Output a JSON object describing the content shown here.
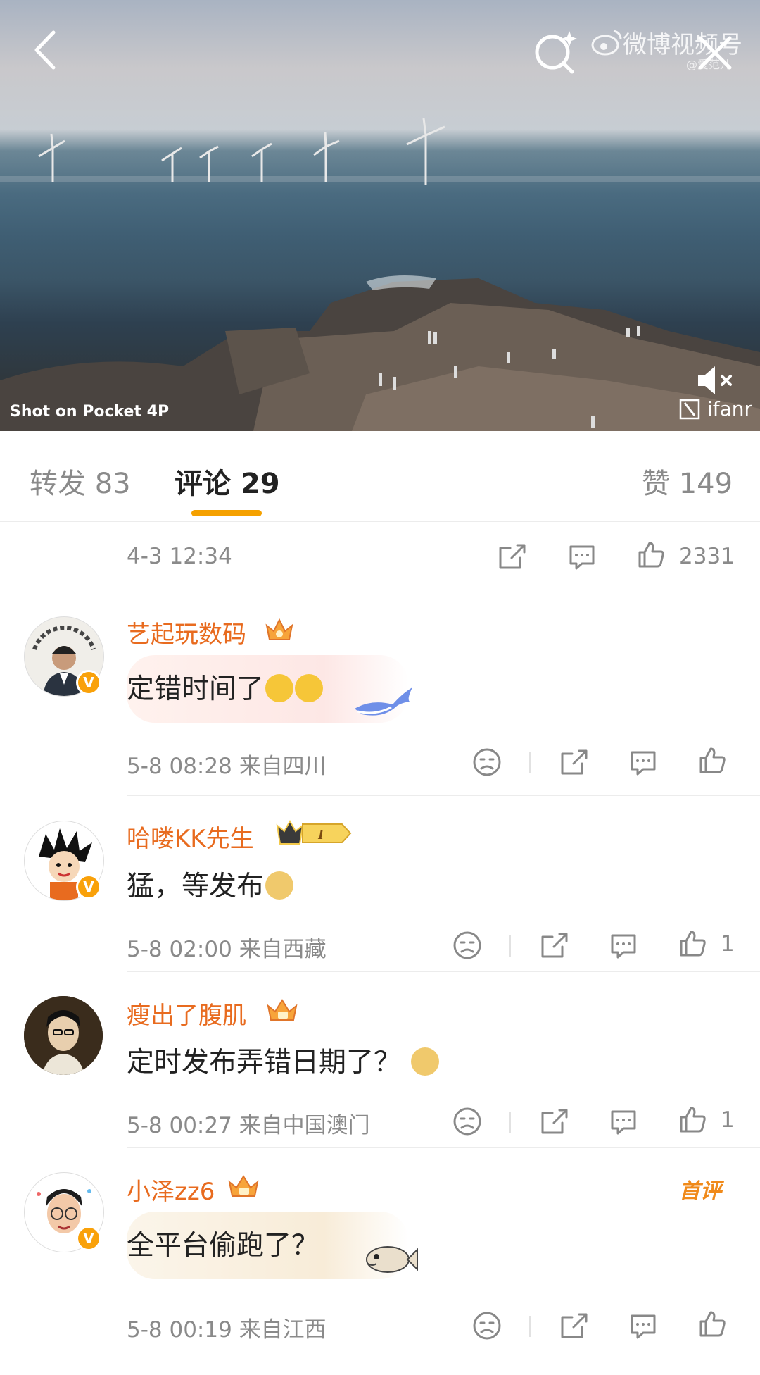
{
  "video": {
    "watermark_brand": "微博视频号",
    "watermark_user": "@爱范儿",
    "caption": "Shot on Pocket 4P",
    "brand": "ifanr"
  },
  "tabs": [
    {
      "label": "转发",
      "count": "83"
    },
    {
      "label": "评论",
      "count": "29"
    },
    {
      "label": "赞",
      "count": "149"
    }
  ],
  "post": {
    "time": "4-3 12:34",
    "likes": "2331"
  },
  "comments": [
    {
      "user": "艺起玩数码",
      "text": "定错时间了",
      "time": "5-8 08:28",
      "location": "来自四川",
      "likes": ""
    },
    {
      "user": "哈喽KK先生",
      "text": "猛，等发布",
      "time": "5-8 02:00",
      "location": "来自西藏",
      "likes": "1"
    },
    {
      "user": "瘦出了腹肌",
      "text": "定时发布弄错日期了？",
      "time": "5-8 00:27",
      "location": "来自中国澳门",
      "likes": "1"
    },
    {
      "user": "小泽zz6",
      "text": "全平台偷跑了？",
      "time": "5-8 00:19",
      "location": "来自江西",
      "likes": "",
      "tag": "首评"
    }
  ],
  "colors": {
    "accent": "#f5a100",
    "username": "#e86b1f",
    "muted": "#8a8a8a"
  }
}
